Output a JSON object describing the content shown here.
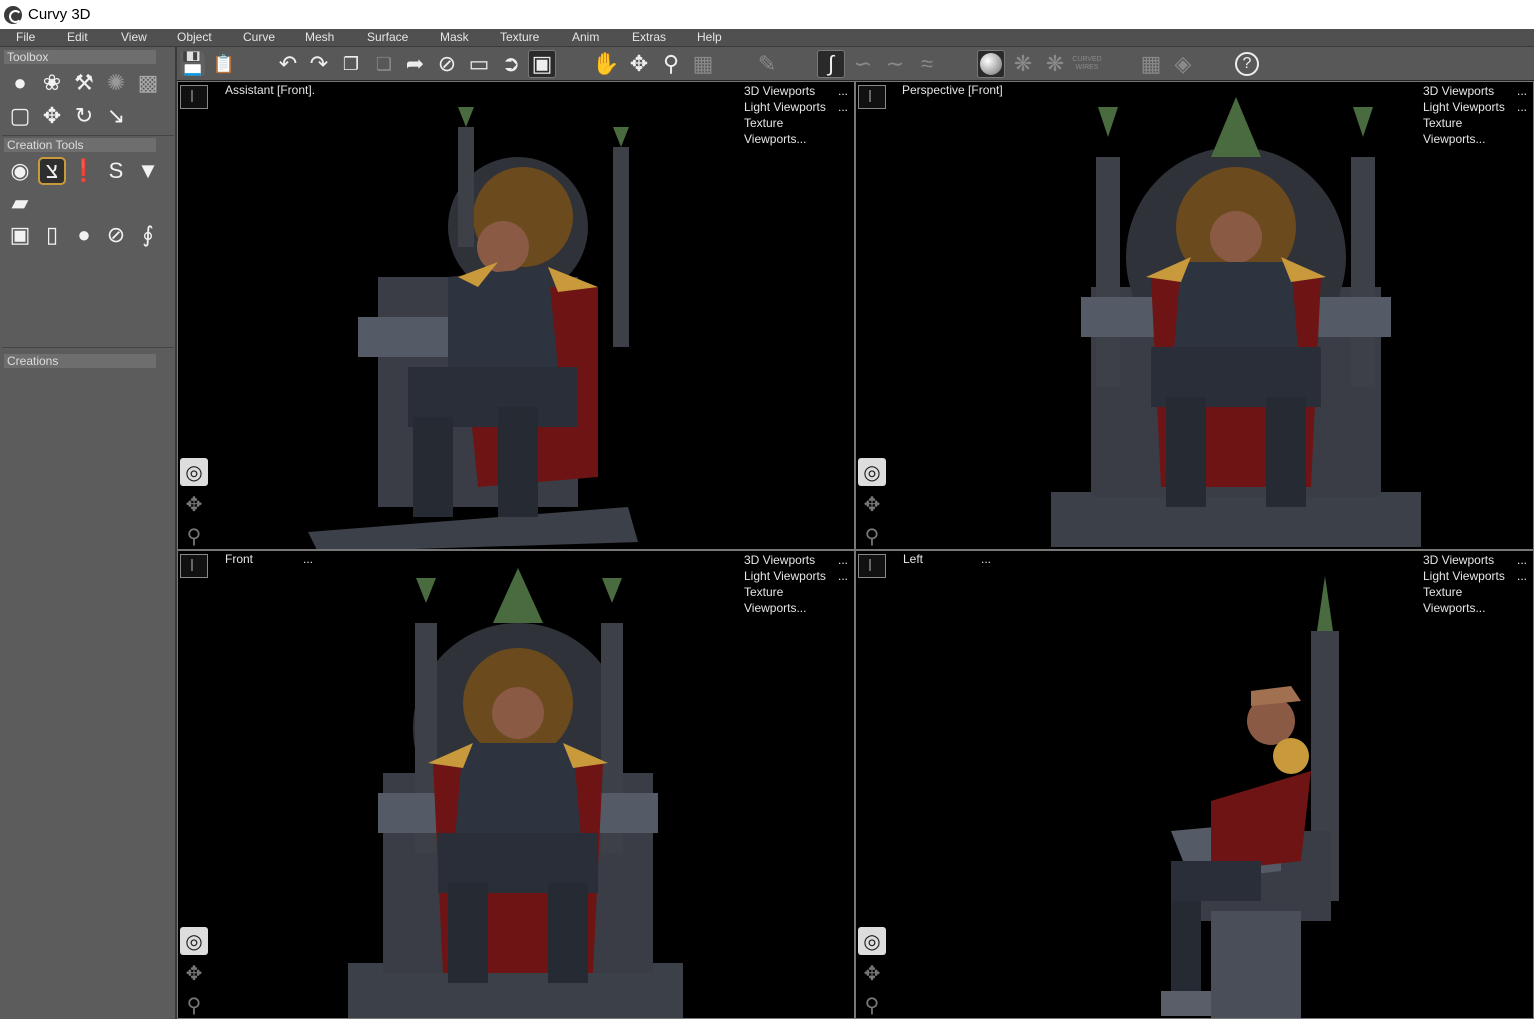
{
  "window": {
    "title": "Curvy 3D"
  },
  "menu": [
    "File",
    "Edit",
    "View",
    "Object",
    "Curve",
    "Mesh",
    "Surface",
    "Mask",
    "Texture",
    "Anim",
    "Extras",
    "Help"
  ],
  "toolbar": {
    "icons": [
      "save-icon",
      "save-as-icon",
      "undo-icon",
      "redo-icon",
      "copy-icon",
      "paste-icon",
      "select-arrow-icon",
      "deselect-icon",
      "rect-select-icon",
      "lasso-select-icon",
      "mask-select-icon",
      "pan-hand-icon",
      "move-view-icon",
      "zoom-icon",
      "grid-icon",
      "edit-curve-icon",
      "curve-draw-icon",
      "curve-smooth-icon",
      "curve-edit-icon",
      "curve-wave-icon",
      "shaded-sphere-icon",
      "wire-sphere-icon",
      "wire-sphere-2-icon",
      "curved-wires-icon",
      "grid-view-icon",
      "diamond-view-icon",
      "help-icon"
    ],
    "curved_wires_label": "CURVED WIRES"
  },
  "sidebar": {
    "toolbox_title": "Toolbox",
    "creation_tools_title": "Creation Tools",
    "creations_title": "Creations"
  },
  "viewports": [
    {
      "name": "Assistant [Front].",
      "dots": "",
      "menu": [
        "3D Viewports",
        "Light Viewports",
        "Texture Viewports..."
      ]
    },
    {
      "name": "Perspective [Front]",
      "dots": "",
      "menu": [
        "3D Viewports",
        "Light Viewports",
        "Texture Viewports..."
      ]
    },
    {
      "name": "Front",
      "dots": "...",
      "menu": [
        "3D Viewports",
        "Light Viewports",
        "Texture Viewports..."
      ]
    },
    {
      "name": "Left",
      "dots": "...",
      "menu": [
        "3D Viewports",
        "Light Viewports",
        "Texture Viewports..."
      ]
    }
  ],
  "menu_dots": "..."
}
